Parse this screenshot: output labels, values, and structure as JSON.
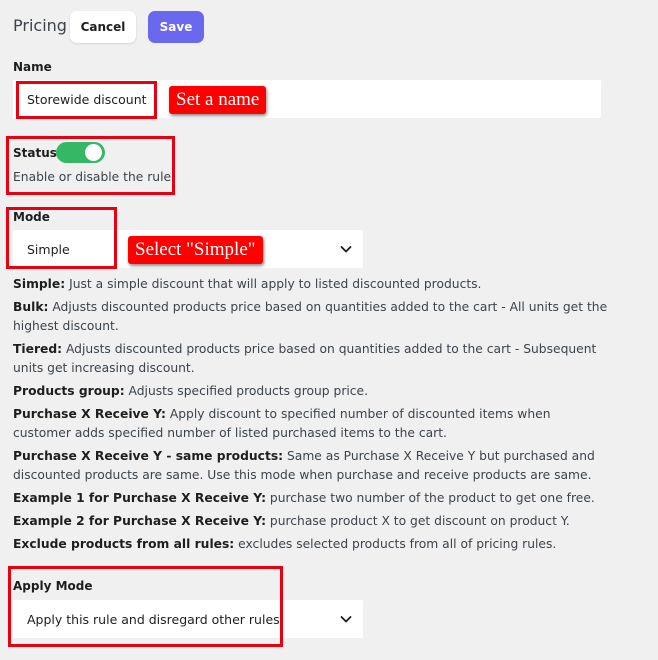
{
  "header": {
    "title": "Pricing",
    "cancel_label": "Cancel",
    "save_label": "Save"
  },
  "name_field": {
    "label": "Name",
    "value": "Storewide discount"
  },
  "status": {
    "label": "Status",
    "enabled": true,
    "help": "Enable or disable the rule."
  },
  "mode": {
    "label": "Mode",
    "selected": "Simple",
    "descriptions": [
      {
        "term": "Simple:",
        "text": " Just a simple discount that will apply to listed discounted products."
      },
      {
        "term": "Bulk:",
        "text": " Adjusts discounted products price based on quantities added to the cart - All units get the highest discount."
      },
      {
        "term": "Tiered:",
        "text": " Adjusts discounted products price based on quantities added to the cart - Subsequent units get increasing discount."
      },
      {
        "term": "Products group:",
        "text": " Adjusts specified products group price."
      },
      {
        "term": "Purchase X Receive Y:",
        "text": " Apply discount to specified number of discounted items when customer adds specified number of listed purchased items to the cart."
      },
      {
        "term": "Purchase X Receive Y - same products:",
        "text": " Same as Purchase X Receive Y but purchased and discounted products are same. Use this mode when purchase and receive products are same."
      },
      {
        "term": "Example 1 for Purchase X Receive Y:",
        "text": " purchase two number of the product to get one free."
      },
      {
        "term": "Example 2 for Purchase X Receive Y:",
        "text": " purchase product X to get discount on product Y."
      },
      {
        "term": "Exclude products from all rules:",
        "text": " excludes selected products from all of pricing rules."
      }
    ]
  },
  "apply_mode": {
    "label": "Apply Mode",
    "selected": "Apply this rule and disregard other rules"
  },
  "annotations": {
    "name_callout": "Set a name",
    "mode_callout": "Select \"Simple\""
  },
  "colors": {
    "accent": "#6a68ee",
    "toggle_on": "#34b866",
    "annotation_red": "#e60012"
  }
}
